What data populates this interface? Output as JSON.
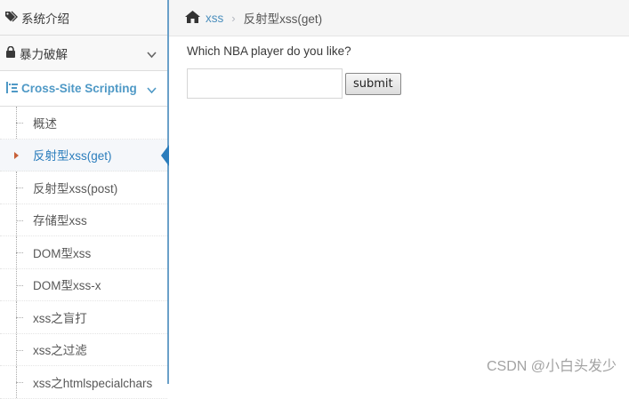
{
  "sidebar": {
    "top_label": "系统介绍",
    "bruteforce_label": "暴力破解",
    "xss_label": "Cross-Site Scripting",
    "sub_items": [
      "概述",
      "反射型xss(get)",
      "反射型xss(post)",
      "存储型xss",
      "DOM型xss",
      "DOM型xss-x",
      "xss之盲打",
      "xss之过滤",
      "xss之htmlspecialchars"
    ]
  },
  "breadcrumb": {
    "link": "xss",
    "current": "反射型xss(get)"
  },
  "main": {
    "question": "Which NBA player do you like?",
    "input_value": "",
    "submit_label": "submit"
  },
  "watermark": "CSDN @小白头发少",
  "colors": {
    "accent": "#4f99c6",
    "active_pointer": "#2b7dbc",
    "caret": "#c86139"
  }
}
